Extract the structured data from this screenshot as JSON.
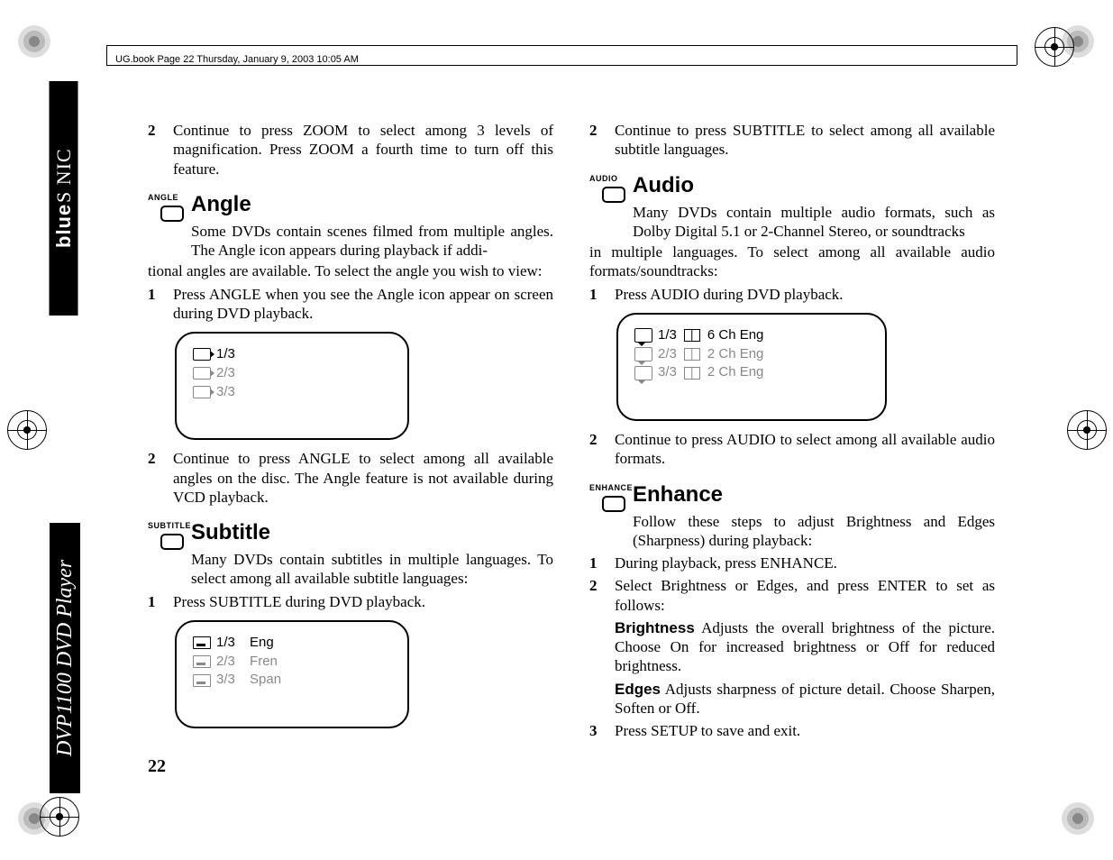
{
  "header": "UG.book  Page 22  Thursday, January 9, 2003  10:05 AM",
  "sidebar": {
    "brand_top": "blue",
    "brand_mid": "S   NIC",
    "product": "DVP1100 DVD Player"
  },
  "page_number": "22",
  "left": {
    "zoom_step2_num": "2",
    "zoom_step2": "Continue to press ZOOM to select among 3 levels of magnification. Press ZOOM a fourth time to turn off this feature.",
    "angle": {
      "label": "ANGLE",
      "title": "Angle",
      "intro1": "Some DVDs contain scenes filmed from multiple angles. The Angle icon appears during playback if addi-",
      "intro2": "tional angles are available. To select the angle you wish to view:",
      "s1_num": "1",
      "s1": "Press ANGLE when you see the Angle icon appear on screen during DVD playback.",
      "osd": [
        "1/3",
        "2/3",
        "3/3"
      ],
      "s2_num": "2",
      "s2": "Continue to press ANGLE to select among all available angles on the disc. The Angle feature is not available during VCD playback."
    },
    "subtitle": {
      "label": "SUBTITLE",
      "title": "Subtitle",
      "intro": "Many DVDs contain subtitles in multiple languages. To select among all available subtitle languages:",
      "s1_num": "1",
      "s1": "Press SUBTITLE during DVD playback.",
      "osd": [
        {
          "idx": "1/3",
          "lang": "Eng"
        },
        {
          "idx": "2/3",
          "lang": "Fren"
        },
        {
          "idx": "3/3",
          "lang": "Span"
        }
      ]
    }
  },
  "right": {
    "sub_s2_num": "2",
    "sub_s2": "Continue to press SUBTITLE to select among all available subtitle languages.",
    "audio": {
      "label": "AUDIO",
      "title": "Audio",
      "intro1": "Many DVDs contain multiple audio formats, such as Dolby Digital 5.1 or 2-Channel Stereo, or soundtracks",
      "intro2": "in multiple languages. To select among all available audio formats/soundtracks:",
      "s1_num": "1",
      "s1": "Press AUDIO during DVD playback.",
      "osd": [
        {
          "idx": "1/3",
          "ch": "6 Ch Eng"
        },
        {
          "idx": "2/3",
          "ch": "2 Ch Eng"
        },
        {
          "idx": "3/3",
          "ch": "2 Ch Eng"
        }
      ],
      "s2_num": "2",
      "s2": "Continue to press AUDIO to select among all available audio formats."
    },
    "enhance": {
      "label": "ENHANCE",
      "title": "Enhance",
      "intro": "Follow these steps to adjust Brightness and Edges (Sharpness) during playback:",
      "s1_num": "1",
      "s1": "During playback, press ENHANCE.",
      "s2_num": "2",
      "s2": "Select Brightness or Edges, and press ENTER to set as follows:",
      "opt1_label": "Brightness",
      "opt1_text": "   Adjusts the overall brightness of the picture. Choose On for increased brightness or Off for reduced brightness.",
      "opt2_label": "Edges",
      "opt2_text": "   Adjusts sharpness of picture detail. Choose Sharpen, Soften or Off.",
      "s3_num": "3",
      "s3": "Press SETUP to save and exit."
    }
  }
}
